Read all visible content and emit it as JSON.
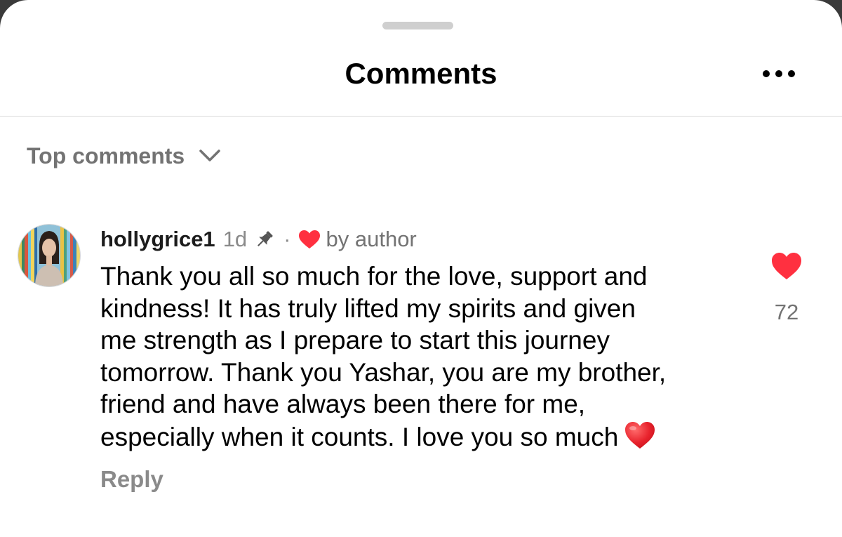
{
  "header": {
    "title": "Comments",
    "more_icon": "more-horizontal-icon"
  },
  "sort": {
    "label": "Top comments",
    "icon": "chevron-down-icon"
  },
  "comment": {
    "username": "hollygrice1",
    "time": "1d",
    "pinned_icon": "pin-icon",
    "separator": "·",
    "liked_by_author_label": "by author",
    "text_lines": [
      "Thank you all so much for the love, support and",
      "kindness! It has truly lifted my spirits and given",
      "me strength as I prepare to start this journey",
      "tomorrow. Thank you Yashar, you are my brother,",
      "friend and have always been there for me,",
      "especially when it counts. I love you so much"
    ],
    "emoji_icon": "red-heart-emoji-icon",
    "reply_label": "Reply",
    "like_count": "72"
  },
  "colors": {
    "like_red": "#ff3040",
    "muted_text": "#737373",
    "divider": "#dbdbdb"
  }
}
